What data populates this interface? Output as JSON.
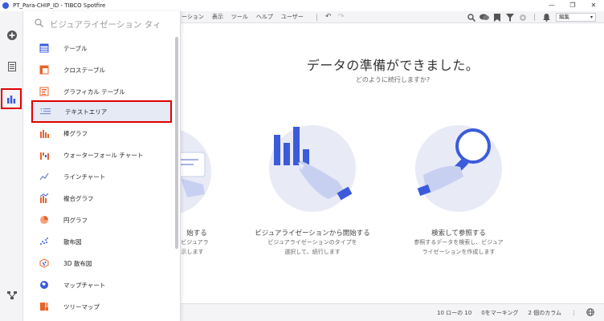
{
  "window": {
    "title": "PT_Para-CHIP_ID - TIBCO Spotfire",
    "controls": [
      "—",
      "❐",
      "✕"
    ]
  },
  "menubar": {
    "items": [
      "ーション",
      "表示",
      "ツール",
      "ヘルプ",
      "ユーザー"
    ],
    "edit_mode": "編集"
  },
  "search": {
    "placeholder": "ビジュアライゼーション タィ"
  },
  "viz_list": [
    {
      "label": "テーブル",
      "icon": "table-icon"
    },
    {
      "label": "クロステーブル",
      "icon": "cross-table-icon"
    },
    {
      "label": "グラフィカル テーブル",
      "icon": "graphical-table-icon"
    },
    {
      "label": "テキストエリア",
      "icon": "text-area-icon",
      "selected": true
    },
    {
      "label": "棒グラフ",
      "icon": "bar-chart-icon"
    },
    {
      "label": "ウォーターフォール チャート",
      "icon": "waterfall-chart-icon"
    },
    {
      "label": "ラインチャート",
      "icon": "line-chart-icon"
    },
    {
      "label": "複合グラフ",
      "icon": "combination-chart-icon"
    },
    {
      "label": "円グラフ",
      "icon": "pie-chart-icon"
    },
    {
      "label": "散布図",
      "icon": "scatter-plot-icon"
    },
    {
      "label": "3D 散布図",
      "icon": "3d-scatter-plot-icon"
    },
    {
      "label": "マップチャート",
      "icon": "map-chart-icon"
    },
    {
      "label": "ツリーマップ",
      "icon": "treemap-icon"
    }
  ],
  "main": {
    "headline": "データの準備ができました。",
    "subline": "どのように続行しますか?",
    "cards": [
      {
        "title": "始する",
        "desc1": "、ビジュアラ",
        "desc2": "表示します"
      },
      {
        "title": "ビジュアライゼーションから開始する",
        "desc1": "ビジュアライゼーションのタイプを",
        "desc2": "選択して、続行します"
      },
      {
        "title": "検索して参照する",
        "desc1": "参照するデータを検索し、ビジュア",
        "desc2": "ライゼーションを作成します"
      }
    ]
  },
  "status": {
    "rows": "10 ローの 10",
    "marking": "0をマーキング",
    "columns": "2 個のカラム"
  },
  "colors": {
    "accent": "#3b5bdb",
    "highlight": "#e00000",
    "viz_orange": "#e8632b"
  }
}
